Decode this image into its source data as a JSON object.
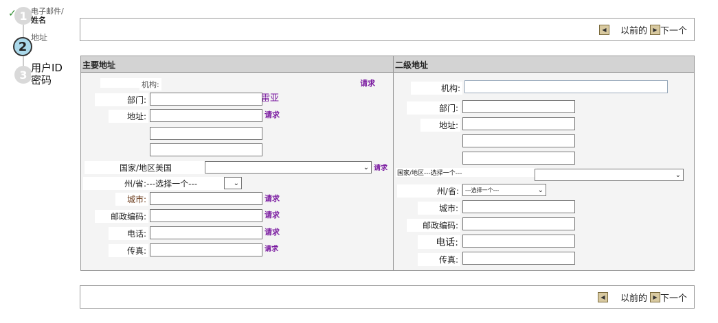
{
  "steps": [
    {
      "number": "1",
      "label_line1": "电子邮件/",
      "label_line2": "姓名"
    },
    {
      "number": "2",
      "label": "地址"
    },
    {
      "number": "3",
      "label_line1": "用户ID",
      "label_line2": "密码"
    }
  ],
  "nav": {
    "prev_label": "以前的",
    "next_label": "下一个"
  },
  "primary": {
    "title": "主要地址",
    "org_label": "机构:",
    "org_required": "请求",
    "dept_label": "部门:",
    "dept_hint": "雷亚",
    "addr_label": "地址:",
    "addr_required": "请求",
    "country_label": "国家/地区美国",
    "country_required": "请求",
    "state_label": "州/省:",
    "state_value": "---选择一个---",
    "city_label": "城市:",
    "city_required": "请求",
    "zip_label": "邮政编码:",
    "zip_required": "请求",
    "phone_label": "电话:",
    "phone_required": "请求",
    "fax_label": "传真:",
    "fax_required": "请求"
  },
  "secondary": {
    "title": "二级地址",
    "org_label": "机构:",
    "dept_label": "部门:",
    "addr_label": "地址:",
    "country_label": "国家/地区---选择一个---",
    "state_label": "州/省:",
    "state_value": "---选择一个---",
    "city_label": "城市:",
    "zip_label": "邮政编码:",
    "phone_label": "电话:",
    "fax_label": "传真:"
  },
  "colors": {
    "required": "#7a1aa0",
    "header_bg": "#d3d3d3",
    "panel_bg": "#f4f4f4",
    "current_step": "#aad8ea",
    "check": "#2a8a2a"
  }
}
